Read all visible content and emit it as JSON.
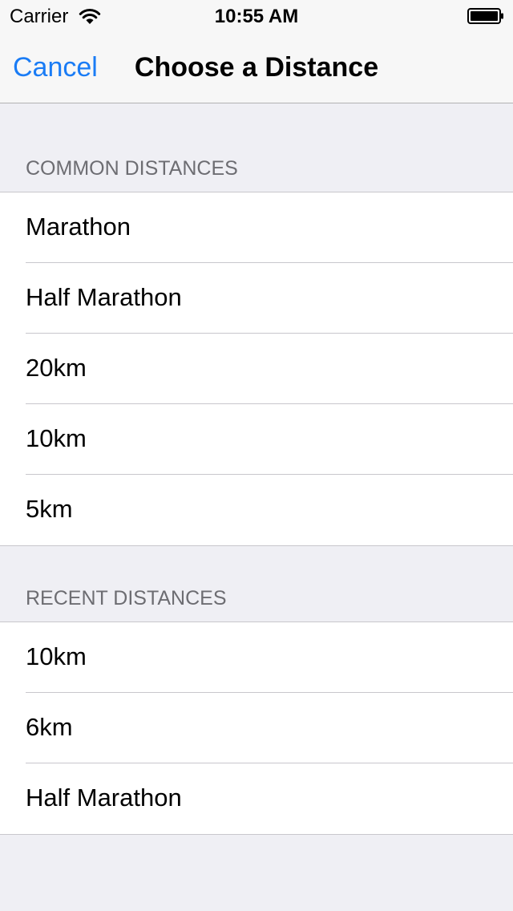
{
  "status_bar": {
    "carrier": "Carrier",
    "time": "10:55 AM",
    "wifi_icon": "wifi-icon",
    "battery_icon": "battery-full-icon"
  },
  "nav": {
    "cancel_label": "Cancel",
    "title": "Choose a Distance",
    "accent_color": "#1a7cf5"
  },
  "sections": {
    "common": {
      "header": "COMMON DISTANCES",
      "items": [
        "Marathon",
        "Half Marathon",
        "20km",
        "10km",
        "5km"
      ]
    },
    "recent": {
      "header": "RECENT DISTANCES",
      "items": [
        "10km",
        "6km",
        "Half Marathon"
      ]
    }
  }
}
